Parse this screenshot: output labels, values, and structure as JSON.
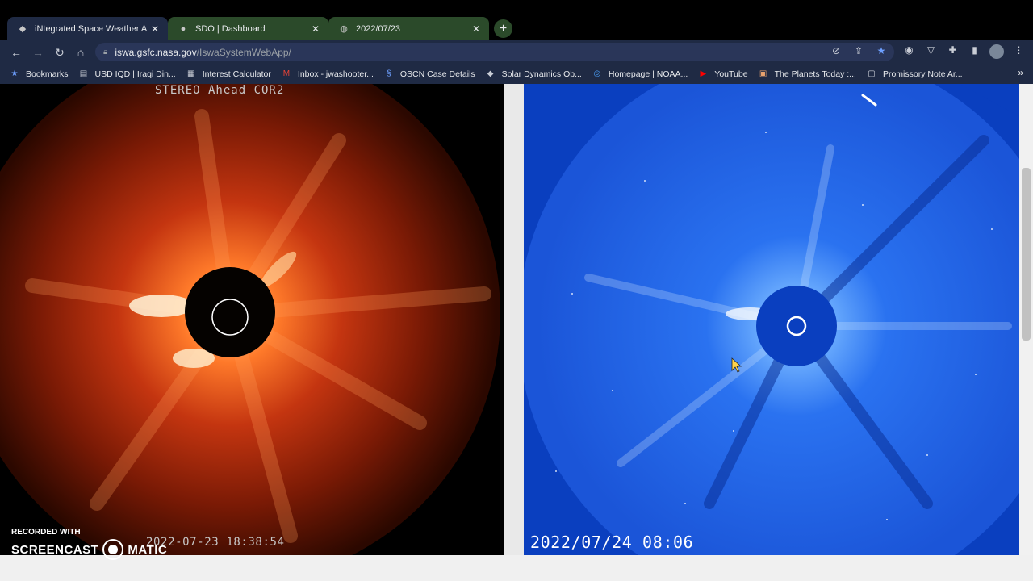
{
  "tabs": [
    {
      "title": "iNtegrated Space Weather Analy",
      "icon": "nasa-icon"
    },
    {
      "title": "SDO | Dashboard",
      "icon": "sdo-icon"
    },
    {
      "title": "2022/07/23",
      "icon": "globe-icon"
    }
  ],
  "address": {
    "host": "iswa.gsfc.nasa.gov",
    "path": "/IswaSystemWebApp/"
  },
  "bookmarks": [
    {
      "label": "Bookmarks",
      "icon": "star-icon"
    },
    {
      "label": "USD IQD | Iraqi Din...",
      "icon": "iqd-icon"
    },
    {
      "label": "Interest Calculator",
      "icon": "calculator-icon"
    },
    {
      "label": "Inbox - jwashooter...",
      "icon": "gmail-icon"
    },
    {
      "label": "OSCN Case Details",
      "icon": "oscn-icon"
    },
    {
      "label": "Solar Dynamics Ob...",
      "icon": "sdo-icon"
    },
    {
      "label": "Homepage | NOAA...",
      "icon": "noaa-icon"
    },
    {
      "label": "YouTube",
      "icon": "youtube-icon"
    },
    {
      "label": "The Planets Today :...",
      "icon": "planets-icon"
    },
    {
      "label": "Promissory Note Ar...",
      "icon": "document-icon"
    }
  ],
  "panels": {
    "left": {
      "title": "STEREO Ahead COR2",
      "timestamp": "2022-07-23  18:38:54"
    },
    "right": {
      "timestamp": "2022/07/24 08:06"
    }
  },
  "watermark": {
    "line1": "RECORDED WITH",
    "brand_left": "SCREENCAST",
    "brand_right": "MATIC"
  },
  "colors": {
    "tab_active": "#1f2a44",
    "tab_inactive": "#2b4a2a",
    "toolbar": "#1f2a44",
    "lasco_blue": "#0a3fbf",
    "cor2_orange": "#d8461a"
  }
}
